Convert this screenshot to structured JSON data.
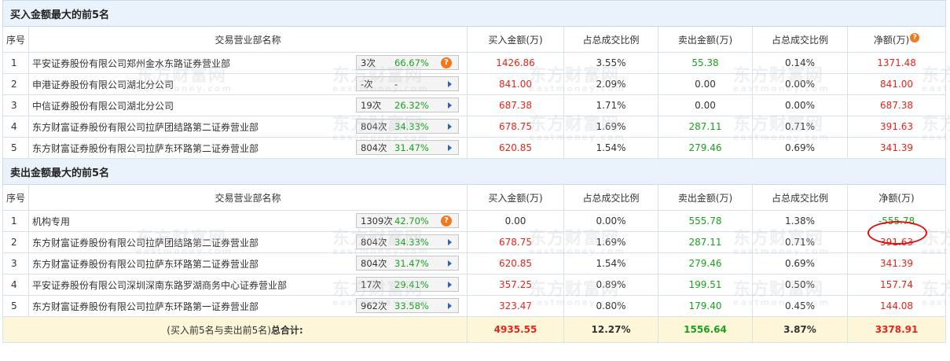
{
  "buy_section": {
    "title": "买入金额最大的前5名",
    "headers": [
      "序号",
      "交易营业部名称",
      "买入金额(万)",
      "占总成交比例",
      "卖出金额(万)",
      "占总成交比例",
      "净额(万)"
    ],
    "rows": [
      {
        "idx": "1",
        "name": "平安证券股份有限公司郑州金水东路证券营业部",
        "count": "3次",
        "pct": "66.67%",
        "icon": "question-icon",
        "buy": "1426.86",
        "buy_ratio": "3.55%",
        "sell": "55.38",
        "sell_ratio": "0.14%",
        "net": "1371.48"
      },
      {
        "idx": "2",
        "name": "申港证券股份有限公司湖北分公司",
        "count": "-次",
        "pct": "-",
        "icon": "arrow-right-icon",
        "buy": "841.00",
        "buy_ratio": "2.09%",
        "sell": "0.00",
        "sell_ratio": "0.00%",
        "net": "841.00"
      },
      {
        "idx": "3",
        "name": "中信证券股份有限公司湖北分公司",
        "count": "19次",
        "pct": "26.32%",
        "icon": "arrow-right-icon",
        "buy": "687.38",
        "buy_ratio": "1.71%",
        "sell": "0.00",
        "sell_ratio": "0.00%",
        "net": "687.38"
      },
      {
        "idx": "4",
        "name": "东方财富证券股份有限公司拉萨团结路第二证券营业部",
        "count": "804次",
        "pct": "34.33%",
        "icon": "arrow-right-icon",
        "buy": "678.75",
        "buy_ratio": "1.69%",
        "sell": "287.11",
        "sell_ratio": "0.71%",
        "net": "391.63"
      },
      {
        "idx": "5",
        "name": "东方财富证券股份有限公司拉萨东环路第二证券营业部",
        "count": "804次",
        "pct": "31.47%",
        "icon": "arrow-right-icon",
        "buy": "620.85",
        "buy_ratio": "1.54%",
        "sell": "279.46",
        "sell_ratio": "0.69%",
        "net": "341.39"
      }
    ]
  },
  "sell_section": {
    "title": "卖出金额最大的前5名",
    "headers": [
      "序号",
      "交易营业部名称",
      "买入金额(万)",
      "占总成交比例",
      "卖出金额(万)",
      "占总成交比例",
      "净额(万)"
    ],
    "rows": [
      {
        "idx": "1",
        "name": "机构专用",
        "count": "1309次",
        "pct": "42.70%",
        "icon": "question-icon",
        "buy": "0.00",
        "buy_ratio": "0.00%",
        "sell": "555.78",
        "sell_ratio": "1.38%",
        "net": "-555.78"
      },
      {
        "idx": "2",
        "name": "东方财富证券股份有限公司拉萨团结路第二证券营业部",
        "count": "804次",
        "pct": "34.33%",
        "icon": "arrow-right-icon",
        "buy": "678.75",
        "buy_ratio": "1.69%",
        "sell": "287.11",
        "sell_ratio": "0.71%",
        "net": "391.63"
      },
      {
        "idx": "3",
        "name": "东方财富证券股份有限公司拉萨东环路第二证券营业部",
        "count": "804次",
        "pct": "31.47%",
        "icon": "arrow-right-icon",
        "buy": "620.85",
        "buy_ratio": "1.54%",
        "sell": "279.46",
        "sell_ratio": "0.69%",
        "net": "341.39"
      },
      {
        "idx": "4",
        "name": "平安证券股份有限公司深圳深南东路罗湖商务中心证券营业部",
        "count": "17次",
        "pct": "29.41%",
        "icon": "arrow-right-icon",
        "buy": "357.25",
        "buy_ratio": "0.89%",
        "sell": "199.51",
        "sell_ratio": "0.50%",
        "net": "157.74"
      },
      {
        "idx": "5",
        "name": "东方财富证券股份有限公司拉萨东环路第一证券营业部",
        "count": "962次",
        "pct": "33.58%",
        "icon": "arrow-right-icon",
        "buy": "323.47",
        "buy_ratio": "0.80%",
        "sell": "179.40",
        "sell_ratio": "0.45%",
        "net": "144.08"
      }
    ]
  },
  "total": {
    "label_prefix": "(买入前5名与卖出前5名)",
    "label_bold": "总合计:",
    "buy": "4935.55",
    "buy_ratio": "12.27%",
    "sell": "1556.64",
    "sell_ratio": "3.87%",
    "net": "3378.91"
  },
  "watermark": {
    "cn": "东方财富网",
    "en": "eastmoney.com"
  },
  "colors": {
    "positive": "#e5251a",
    "negative": "#19a11c",
    "header_bg": "#eaf3fb",
    "total_bg": "#fdf6d9",
    "highlight_circle": "#e01010"
  }
}
